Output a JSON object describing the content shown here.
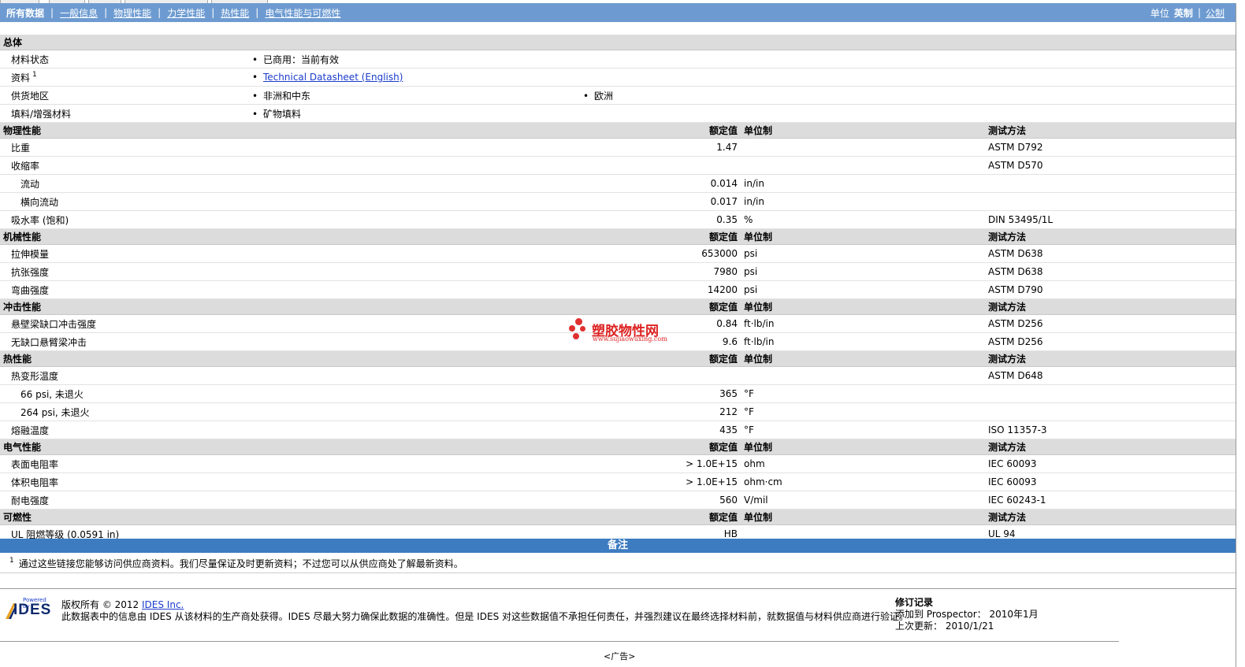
{
  "nav": {
    "items": [
      "所有数据",
      "一般信息",
      "物理性能",
      "力学性能",
      "热性能",
      "电气性能与可燃性"
    ],
    "unit_label": "单位",
    "unit_english": "英制",
    "unit_metric": "公制"
  },
  "general": {
    "section": "总体",
    "status_label": "材料状态",
    "status_value": "已商用：当前有效",
    "doc_label": "资料",
    "doc_sup": "1",
    "doc_value": "Technical Datasheet (English)",
    "region_label": "供货地区",
    "region_1": "非洲和中东",
    "region_2": "欧洲",
    "filler_label": "填料/增强材料",
    "filler_value": "矿物填料"
  },
  "headers": {
    "nominal": "额定值",
    "unit": "单位制",
    "method": "测试方法"
  },
  "physical": {
    "section": "物理性能",
    "rows": [
      {
        "name": "比重",
        "value": "1.47",
        "unit": "",
        "method": "ASTM D792"
      },
      {
        "name": "收缩率",
        "value": "",
        "unit": "",
        "method": "ASTM D570"
      },
      {
        "name": "流动",
        "value": "0.014",
        "unit": "in/in",
        "method": ""
      },
      {
        "name": "横向流动",
        "value": "0.017",
        "unit": "in/in",
        "method": ""
      },
      {
        "name": "吸水率 (饱和)",
        "value": "0.35",
        "unit": "%",
        "method": "DIN 53495/1L"
      }
    ]
  },
  "mechanical": {
    "section": "机械性能",
    "rows": [
      {
        "name": "拉伸模量",
        "value": "653000",
        "unit": "psi",
        "method": "ASTM D638"
      },
      {
        "name": "抗张强度",
        "value": "7980",
        "unit": "psi",
        "method": "ASTM D638"
      },
      {
        "name": "弯曲强度",
        "value": "14200",
        "unit": "psi",
        "method": "ASTM D790"
      }
    ]
  },
  "impact": {
    "section": "冲击性能",
    "rows": [
      {
        "name": "悬壁梁缺口冲击强度",
        "value": "0.84",
        "unit": "ft·lb/in",
        "method": "ASTM D256"
      },
      {
        "name": "无缺口悬臂梁冲击",
        "value": "9.6",
        "unit": "ft·lb/in",
        "method": "ASTM D256"
      }
    ]
  },
  "thermal": {
    "section": "热性能",
    "rows": [
      {
        "name": "热变形温度",
        "value": "",
        "unit": "",
        "method": "ASTM D648"
      },
      {
        "name": "66 psi, 未退火",
        "value": "365",
        "unit": "°F",
        "method": ""
      },
      {
        "name": "264 psi, 未退火",
        "value": "212",
        "unit": "°F",
        "method": ""
      },
      {
        "name": "熔融温度",
        "value": "435",
        "unit": "°F",
        "method": "ISO 11357-3"
      }
    ]
  },
  "electrical": {
    "section": "电气性能",
    "rows": [
      {
        "name": "表面电阻率",
        "value": "> 1.0E+15",
        "unit": "ohm",
        "method": "IEC 60093"
      },
      {
        "name": "体积电阻率",
        "value": "> 1.0E+15",
        "unit": "ohm·cm",
        "method": "IEC 60093"
      },
      {
        "name": "耐电强度",
        "value": "560",
        "unit": "V/mil",
        "method": "IEC 60243-1"
      }
    ]
  },
  "flammability": {
    "section": "可燃性",
    "rows": [
      {
        "name": "UL 阻燃等级 (0.0591 in)",
        "value": "HB",
        "unit": "",
        "method": "UL 94"
      }
    ]
  },
  "notes": {
    "title": "备注",
    "sup": "1",
    "text": "通过这些链接您能够访问供应商资料。我们尽量保证及时更新资料；不过您可以从供应商处了解最新资料。"
  },
  "footer": {
    "logo_small": "Powered by",
    "logo_word": "IDES",
    "copyright": "版权所有 © 2012",
    "company": "IDES Inc.",
    "disclaimer": "此数据表中的信息由 IDES 从该材料的生产商处获得。IDES 尽最大努力确保此数据的准确性。但是 IDES 对这些数据值不承担任何责任，并强烈建议在最终选择材料前，就数据值与材料供应商进行验证。",
    "rev_title": "修订记录",
    "rev_added": "添加到 Prospector： 2010年1月",
    "rev_updated": "上次更新： 2010/1/21",
    "ad": "<广告>"
  },
  "watermark": {
    "text": "塑胶物性网",
    "url": "www.sujiaowuxing.com"
  },
  "colors": {
    "nav_bg": "#6d9bd1",
    "notes_bg": "#3d7cc0",
    "section_bg": "#dcdcdc",
    "link": "#1a3ccc",
    "watermark": "#d22222"
  }
}
